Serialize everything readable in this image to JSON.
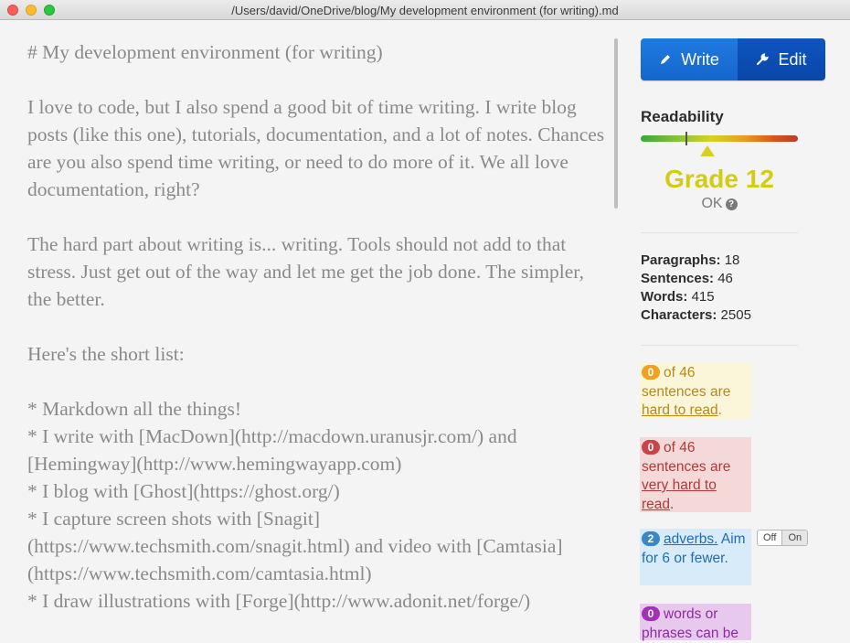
{
  "window": {
    "title": "/Users/david/OneDrive/blog/My development environment (for writing).md"
  },
  "editor": {
    "content": "# My development environment (for writing)\n\nI love to code, but I also spend a good bit of time writing. I write blog posts (like this one), tutorials, documentation, and a lot of notes. Chances are you also spend time writing, or need to do more of it. We all love documentation, right?\n\nThe hard part about writing is... writing. Tools should not add to that stress. Just get out of the way and let me get the job done. The simpler, the better.\n\nHere's the short list:\n\n* Markdown all the things!\n* I write with [MacDown](http://macdown.uranusjr.com/) and [Hemingway](http://www.hemingwayapp.com)\n* I blog with [Ghost](https://ghost.org/)\n* I capture screen shots with [Snagit](https://www.techsmith.com/snagit.html) and video with [Camtasia](https://www.techsmith.com/camtasia.html)\n* I draw illustrations with [Forge](http://www.adonit.net/forge/)"
  },
  "sidebar": {
    "write_label": "Write",
    "edit_label": "Edit",
    "readability_title": "Readability",
    "grade": "Grade 12",
    "grade_status": "OK",
    "stats": [
      {
        "label": "Paragraphs:",
        "value": "18"
      },
      {
        "label": "Sentences:",
        "value": "46"
      },
      {
        "label": "Words:",
        "value": "415"
      },
      {
        "label": "Characters:",
        "value": "2505"
      }
    ],
    "hard": {
      "count": "0",
      "text1": "of 46 sentences are ",
      "link": "hard to read",
      "end": "."
    },
    "very_hard": {
      "count": "0",
      "text1": "of 46 sentences are ",
      "link": "very hard to read",
      "end": "."
    },
    "adverbs": {
      "count": "2",
      "link": "adverbs.",
      "text2": " Aim for 6 or fewer."
    },
    "phrases": {
      "count": "0",
      "text1": "words or phrases can be"
    },
    "toggle_off": "Off",
    "toggle_on": "On"
  },
  "colors": {
    "write_button": "#1a6fd6",
    "edit_button": "#0b4db3",
    "grade": "#d2cb18"
  },
  "icons": {
    "write": "pencil-icon",
    "edit": "wrench-icon",
    "help": "question-circle-icon"
  }
}
